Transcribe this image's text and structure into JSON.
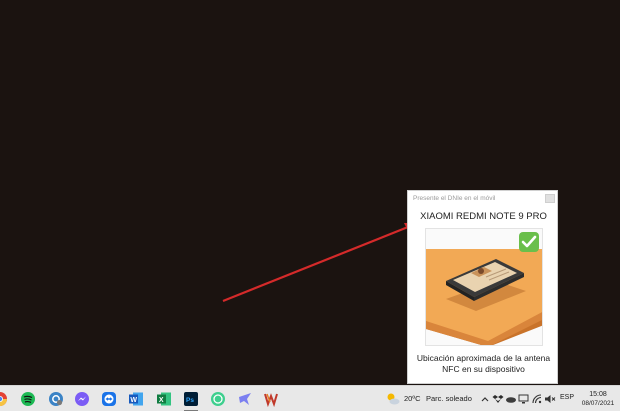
{
  "popup": {
    "title": "Presente el DNIe en el móvil",
    "device_name": "XIAOMI REDMI NOTE 9 PRO",
    "caption": "Ubicación aproximada de la antena NFC en su dispositivo",
    "check_icon": "check-icon",
    "accent_color": "#6abf4b"
  },
  "taskbar": {
    "pinned_icons": [
      "chrome-icon",
      "spotify-icon",
      "settings-icon",
      "messenger-icon",
      "teamviewer-icon",
      "word-icon",
      "excel-icon",
      "photoshop-icon",
      "spotify-green-icon",
      "bird-app-icon",
      "winrar-icon"
    ],
    "weather": {
      "temperature": "20ºC",
      "condition": "Parc. soleado",
      "icon": "partly-sunny-icon"
    },
    "language": "ESP",
    "time": "15:08",
    "date": "08/07/2021"
  },
  "colors": {
    "desktop_background": "#1b1310",
    "arrow": "#d42a2a",
    "taskbar": "#e8e8e8"
  }
}
